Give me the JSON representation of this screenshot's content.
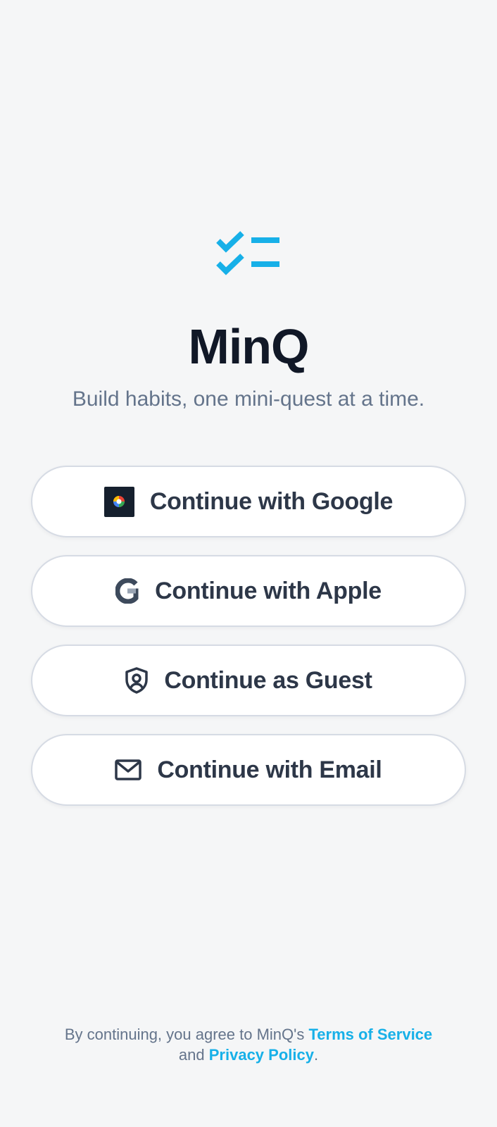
{
  "app": {
    "title": "MinQ",
    "tagline": "Build habits, one mini-quest at a time.",
    "logo_icon": "checklist-icon"
  },
  "auth_buttons": [
    {
      "label": "Continue with Google",
      "icon": "google-icon"
    },
    {
      "label": "Continue with Apple",
      "icon": "apple-icon"
    },
    {
      "label": "Continue as Guest",
      "icon": "shield-user-icon"
    },
    {
      "label": "Continue with Email",
      "icon": "mail-icon"
    }
  ],
  "footer": {
    "prefix": "By continuing, you agree to MinQ's",
    "terms_label": "Terms of Service",
    "connector": "and",
    "privacy_label": "Privacy Policy",
    "suffix": "."
  },
  "colors": {
    "background": "#f5f6f7",
    "accent": "#17b0e8",
    "title": "#111827",
    "button_text": "#2d3748",
    "muted_text": "#64748b",
    "button_border": "#d6dbe4"
  }
}
